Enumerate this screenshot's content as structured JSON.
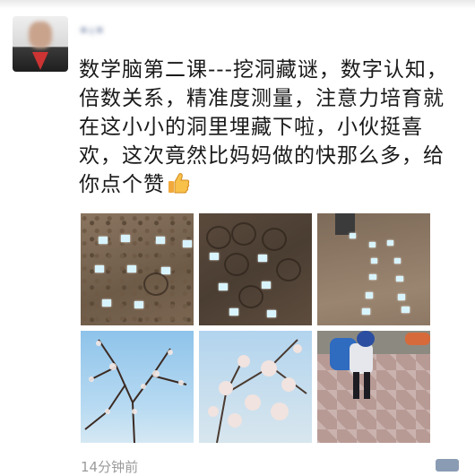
{
  "post": {
    "author": "•‹•",
    "text": "数学脑第二课---挖洞藏谜，数字认知，倍数关系，精准度测量，注意力培育就在这小小的洞里埋藏下啦，小伙挺喜欢，这次竟然比妈妈做的快那么多，给你点个赞",
    "timestamp": "14分钟前"
  },
  "photos": [
    {
      "label": "cards-on-soil-1"
    },
    {
      "label": "cards-on-soil-2"
    },
    {
      "label": "cards-rows-soil"
    },
    {
      "label": "blossom-tree-1"
    },
    {
      "label": "blossom-tree-2"
    },
    {
      "label": "child-walking"
    }
  ],
  "icons": {
    "thumb": "thumbs-up-icon",
    "comment": "comment-icon"
  },
  "colors": {
    "author_name": "#576b95",
    "text": "#1a1a1a",
    "timestamp": "#9b9b9b"
  }
}
